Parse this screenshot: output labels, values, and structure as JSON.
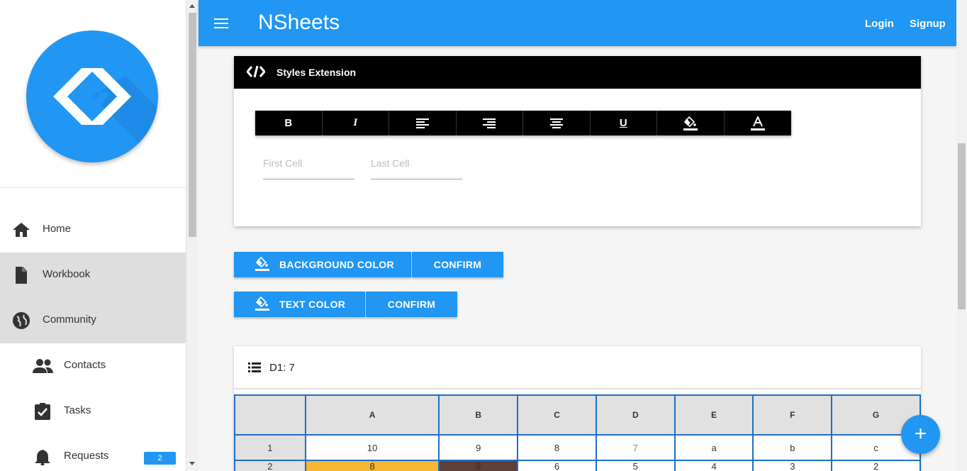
{
  "app": {
    "title": "NSheets",
    "login": "Login",
    "signup": "Signup"
  },
  "sidebar": {
    "items": [
      {
        "label": "Home",
        "icon": "home-icon"
      },
      {
        "label": "Workbook",
        "icon": "document-icon"
      },
      {
        "label": "Community",
        "icon": "globe-icon"
      },
      {
        "label": "Contacts",
        "icon": "people-icon"
      },
      {
        "label": "Tasks",
        "icon": "clipboard-check-icon"
      },
      {
        "label": "Requests",
        "icon": "bell-icon",
        "badge": "2"
      }
    ]
  },
  "styles_card": {
    "title": "Styles Extension",
    "toolbar": [
      "B",
      "I",
      "align-left",
      "align-right",
      "align-center",
      "U",
      "fill-color",
      "text-color"
    ],
    "first_cell_placeholder": "First Cell",
    "last_cell_placeholder": "Last Cell"
  },
  "color_actions": {
    "background_label": "BACKGROUND COLOR",
    "background_confirm": "CONFIRM",
    "text_label": "TEXT COLOR",
    "text_confirm": "CONFIRM"
  },
  "sheet": {
    "cell_info": "D1: 7",
    "columns": [
      "A",
      "B",
      "C",
      "D",
      "E",
      "F",
      "G"
    ],
    "rows": [
      {
        "label": "1",
        "cells": [
          "10",
          "9",
          "8",
          "7",
          "a",
          "b",
          "c"
        ]
      },
      {
        "label": "2",
        "cells": [
          "8",
          "9",
          "6",
          "5",
          "4",
          "3",
          "2"
        ]
      }
    ]
  },
  "colors": {
    "accent": "#2196f3",
    "toolbar": "#000000",
    "cell_d1_text": "#4caf50",
    "cell_a2_bg": "#f5b731",
    "cell_b2_bg": "#5d4037"
  },
  "fab": {
    "label": "+"
  }
}
